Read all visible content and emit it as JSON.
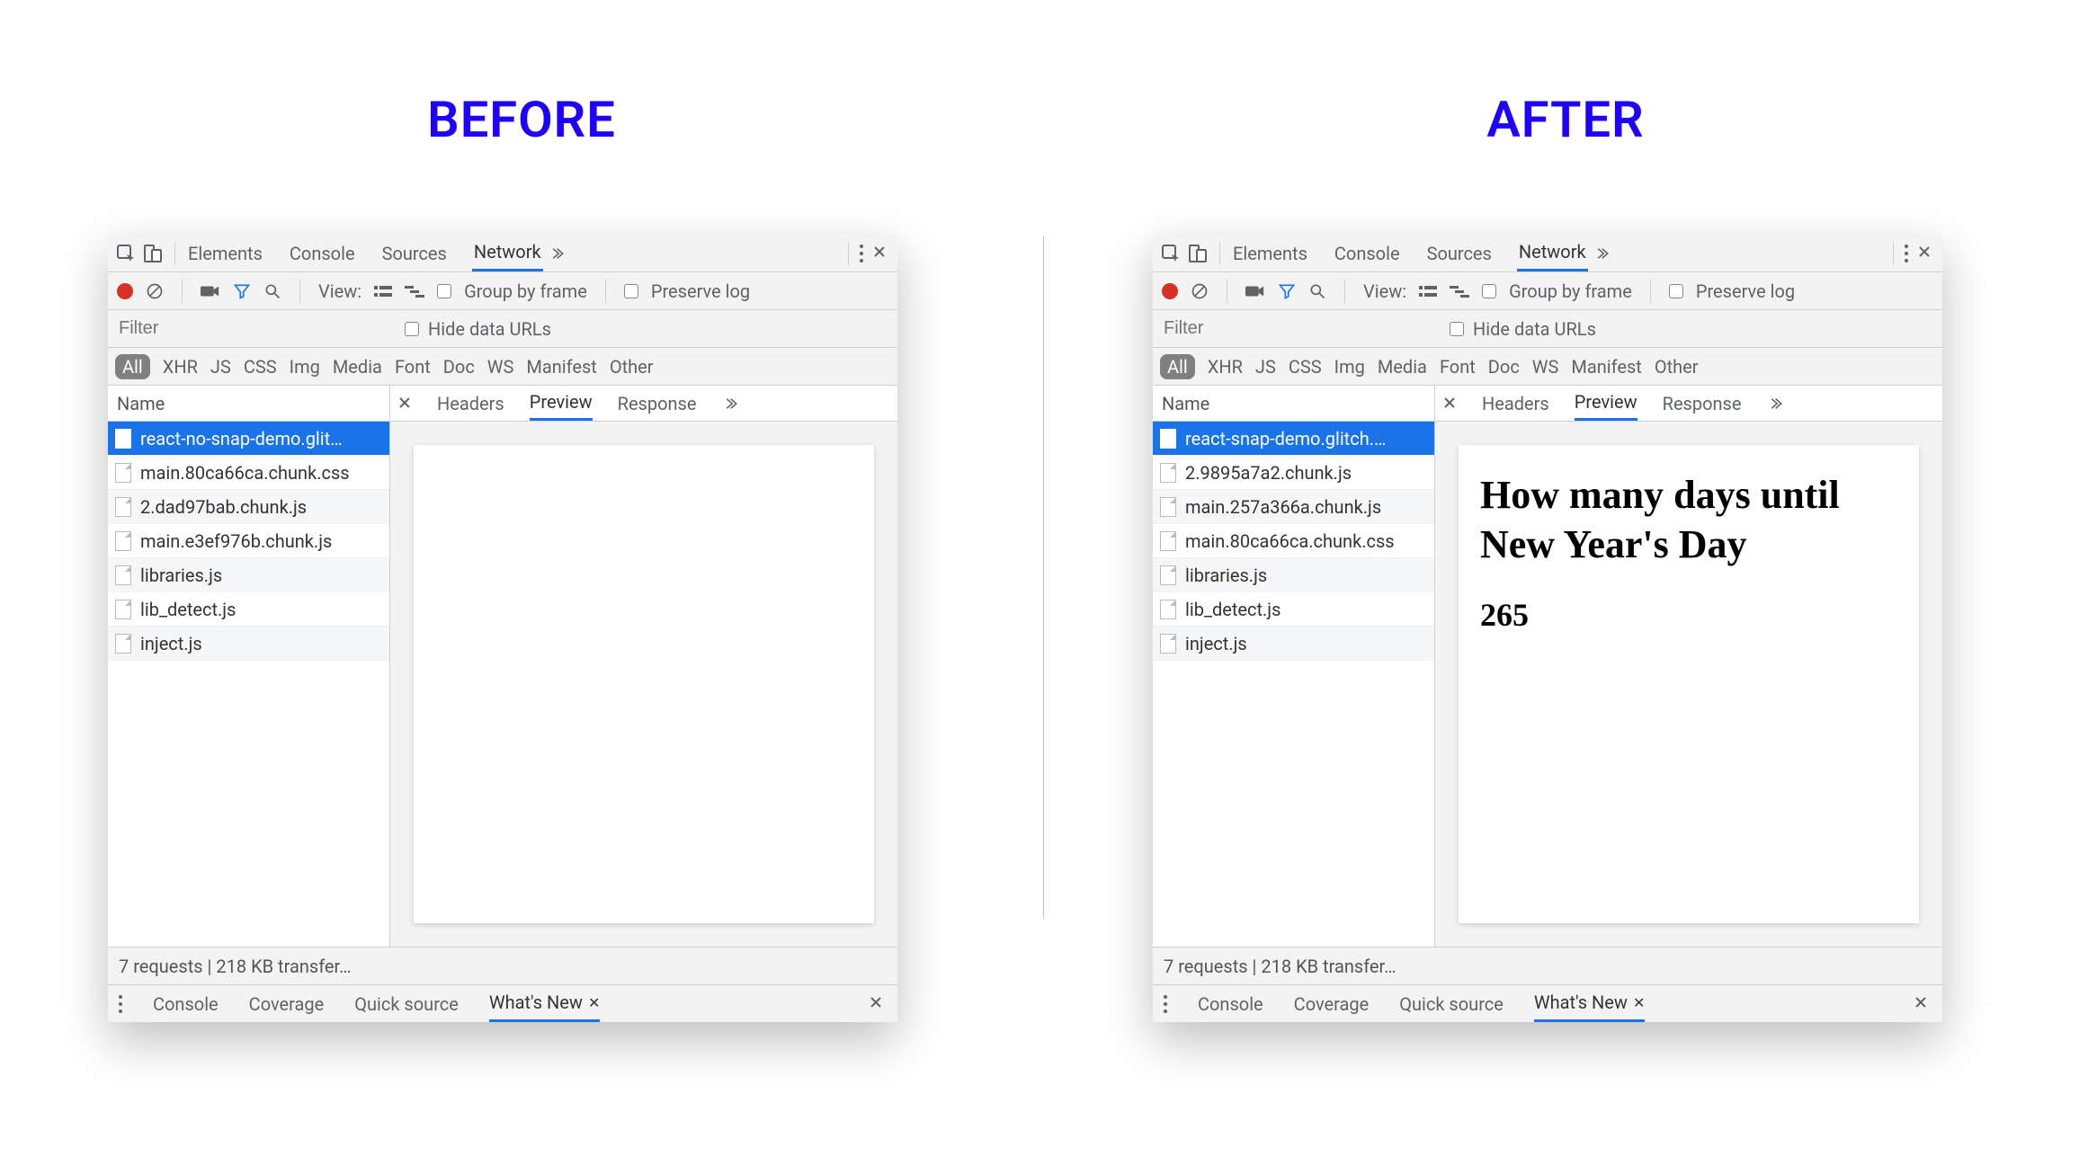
{
  "headings": {
    "before": "BEFORE",
    "after": "AFTER"
  },
  "devtools": {
    "top_tabs": [
      "Elements",
      "Console",
      "Sources",
      "Network"
    ],
    "active_top_tab": "Network",
    "toolbar": {
      "view_label": "View:",
      "group_by_frame": "Group by frame",
      "preserve_log": "Preserve log"
    },
    "filter": {
      "placeholder": "Filter",
      "hide_data_urls": "Hide data URLs"
    },
    "type_chips": [
      "All",
      "XHR",
      "JS",
      "CSS",
      "Img",
      "Media",
      "Font",
      "Doc",
      "WS",
      "Manifest",
      "Other"
    ],
    "name_header": "Name",
    "detail_tabs": [
      "Headers",
      "Preview",
      "Response"
    ],
    "active_detail_tab": "Preview",
    "status": "7 requests | 218 KB transfer…",
    "drawer_tabs": [
      "Console",
      "Coverage",
      "Quick source",
      "What's New"
    ],
    "active_drawer_tab": "What's New"
  },
  "before": {
    "requests": [
      "react-no-snap-demo.glit…",
      "main.80ca66ca.chunk.css",
      "2.dad97bab.chunk.js",
      "main.e3ef976b.chunk.js",
      "libraries.js",
      "lib_detect.js",
      "inject.js"
    ],
    "selected_index": 0,
    "preview": {
      "title": "",
      "count": ""
    }
  },
  "after": {
    "requests": [
      "react-snap-demo.glitch.…",
      "2.9895a7a2.chunk.js",
      "main.257a366a.chunk.js",
      "main.80ca66ca.chunk.css",
      "libraries.js",
      "lib_detect.js",
      "inject.js"
    ],
    "selected_index": 0,
    "preview": {
      "title": "How many days until New Year's Day",
      "count": "265"
    }
  }
}
